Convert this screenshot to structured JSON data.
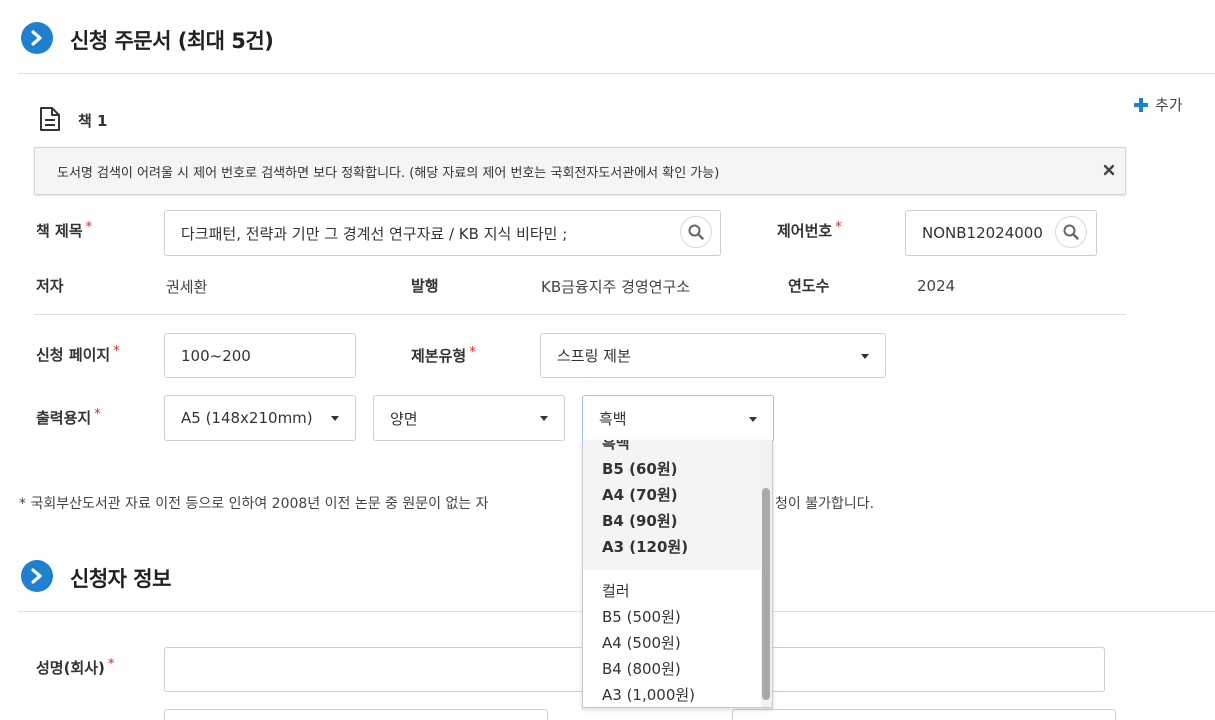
{
  "order_section": {
    "title": "신청 주문서 (최대 5건)",
    "add_label": "추가"
  },
  "book": {
    "heading": "책 1",
    "notice": "도서명 검색이 어려울 시 제어 번호로 검색하면 보다 정확합니다. (해당 자료의 제어 번호는 국회전자도서관에서 확인 가능)",
    "title_label": "책 제목",
    "title_value": "다크패턴, 전략과 기만 그 경계선 연구자료 / KB 지식 비타민 ;",
    "control_label": "제어번호",
    "control_value": "NONB12024000",
    "author_label": "저자",
    "author_value": "권세환",
    "publisher_label": "발행",
    "publisher_value": "KB금융지주 경영연구소",
    "year_label": "연도수",
    "year_value": "2024",
    "pages_label": "신청 페이지",
    "pages_value": "100~200",
    "binding_label": "제본유형",
    "binding_value": "스프링 제본",
    "paper_label": "출력용지",
    "paper_size_value": "A5 (148x210mm)",
    "sides_value": "양면",
    "color_value": "흑백",
    "required_mark": "*"
  },
  "color_dropdown": {
    "groups": [
      {
        "label": "흑백",
        "options": [
          "B5 (60원)",
          "A4 (70원)",
          "B4 (90원)",
          "A3 (120원)"
        ]
      },
      {
        "label": "컬러",
        "options": [
          "B5 (500원)",
          "A4 (500원)",
          "B4 (800원)",
          "A3 (1,000원)"
        ]
      }
    ]
  },
  "footnote_left": "* 국회부산도서관 자료 이전 등으로 인하여 2008년 이전 논문 중 원문이 없는 자",
  "footnote_right": "청이 불가합니다.",
  "applicant_section": {
    "title": "신청자 정보",
    "name_label": "성명(회사)"
  },
  "colors": {
    "accent": "#1f7fd0",
    "required": "#e02424"
  }
}
